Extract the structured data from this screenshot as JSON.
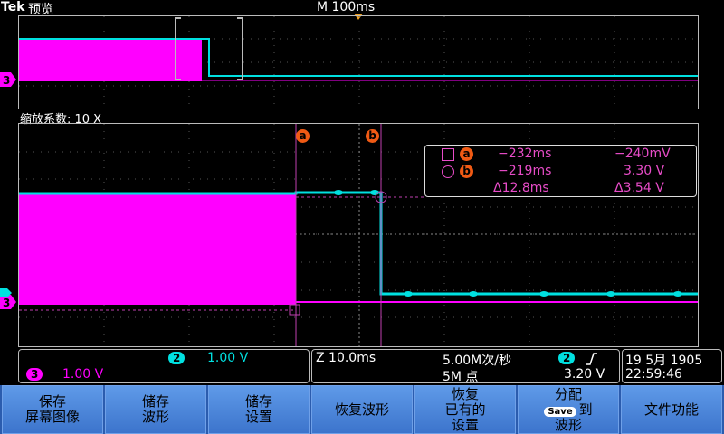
{
  "header": {
    "brand": "Tek",
    "mode": "预览",
    "timebase": "M 100ms"
  },
  "zoom": {
    "label": "缩放系数: 10 X"
  },
  "channels": {
    "ch3_marker": "3",
    "ch3_color": "#ff00ff",
    "ch2_color": "#00e0e0"
  },
  "cursors": {
    "a_label": "a",
    "b_label": "b",
    "a_time": "−232ms",
    "a_volt": "−240mV",
    "b_time": "−219ms",
    "b_volt": "3.30 V",
    "delta_time": "Δ12.8ms",
    "delta_volt": "Δ3.54 V"
  },
  "status_left": {
    "ch2_num": "2",
    "ch2_scale": "1.00 V",
    "ch3_num": "3",
    "ch3_scale": "1.00 V"
  },
  "status_center": {
    "zoom_time": "Z 10.0ms",
    "sample_rate": "5.00M次/秒",
    "record_length": "5M 点",
    "trig_ch": "2",
    "trig_slope_icon": "rising-edge-icon",
    "trig_level": "3.20 V"
  },
  "status_right": {
    "date": "19 5月  1905",
    "time": "22:59:46"
  },
  "menu": {
    "b1_line1": "保存",
    "b1_line2": "屏幕图像",
    "b2_line1": "储存",
    "b2_line2": "波形",
    "b3_line1": "储存",
    "b3_line2": "设置",
    "b4_line1": "恢复波形",
    "b5_line1": "恢复",
    "b5_line2": "已有的",
    "b5_line3": "设置",
    "b6_line1": "分配",
    "b6_chip": "Save",
    "b6_line2": "到",
    "b6_line3": "波形",
    "b7_line1": "文件功能"
  }
}
